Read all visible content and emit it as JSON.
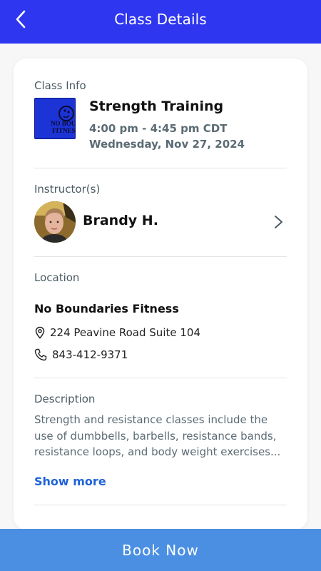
{
  "header": {
    "title": "Class Details",
    "back_icon": "chevron-left-icon"
  },
  "class_info": {
    "section_label": "Class Info",
    "logo_text": [
      "NO BOU",
      "FITNES"
    ],
    "name": "Strength Training",
    "time": "4:00 pm - 4:45 pm CDT",
    "date": "Wednesday, Nov 27, 2024"
  },
  "instructor": {
    "section_label": "Instructor(s)",
    "name": "Brandy H."
  },
  "location": {
    "section_label": "Location",
    "name": "No Boundaries Fitness",
    "address": "224 Peavine Road Suite 104",
    "phone": "843-412-9371"
  },
  "description": {
    "section_label": "Description",
    "text": "Strength and resistance classes include the use of dumbbells, barbells, resistance bands, resistance loops, and body weight exercises...",
    "show_more_label": "Show more"
  },
  "footer": {
    "book_label": "Book Now"
  },
  "colors": {
    "header_bg": "#2f36f0",
    "book_button_bg": "#4a8fe2",
    "link": "#1e63d8",
    "muted_text": "#5b6b74"
  }
}
